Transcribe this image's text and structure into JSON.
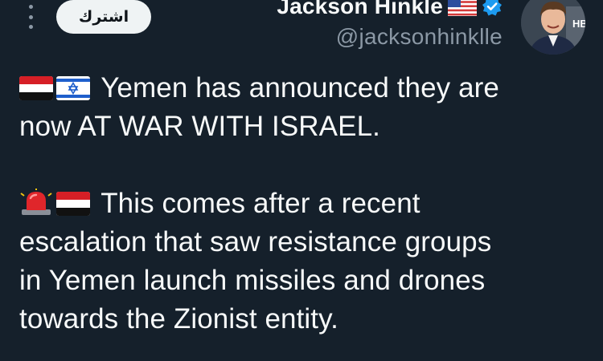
{
  "header": {
    "more_icon": "more-vertical-icon",
    "subscribe_label": "اشترك",
    "author": {
      "name": "Jackson Hinkle",
      "handle": "@jacksonhinklle",
      "flag_icon": "us-flag-icon",
      "verified_icon": "verified-badge-icon",
      "avatar_badge_text": "HB"
    }
  },
  "tweet": {
    "paragraph_1": {
      "emoji_icons": [
        "yemen-flag-icon",
        "israel-flag-icon"
      ],
      "line_1": "Yemen has announced they are",
      "line_2": "now AT WAR WITH ISRAEL."
    },
    "paragraph_2": {
      "emoji_icons": [
        "police-light-icon",
        "yemen-flag-icon"
      ],
      "line_1": "This comes after a recent",
      "line_2": "escalation that saw resistance groups",
      "line_3": "in Yemen launch missiles and drones",
      "line_4": "towards the Zionist entity."
    }
  },
  "colors": {
    "background": "#15202b",
    "text_primary": "#f7f9f9",
    "text_secondary": "#8b98a5",
    "verified_blue": "#1d9bf0",
    "button_bg": "#eff3f4"
  }
}
